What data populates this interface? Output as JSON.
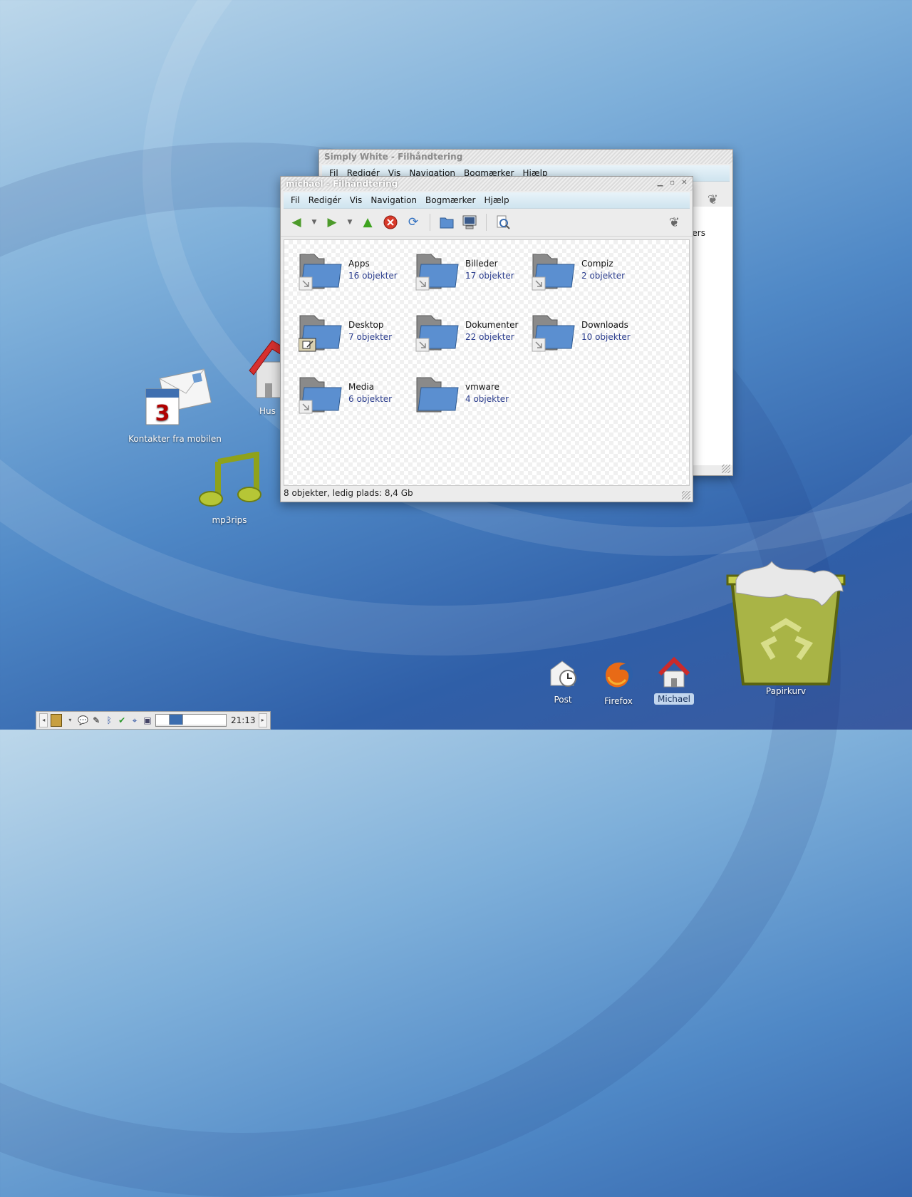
{
  "desktop": {
    "icons": [
      {
        "label": "Kontakter fra mobilen"
      },
      {
        "label": "Hus"
      },
      {
        "label": "mp3rips"
      }
    ],
    "dock": [
      {
        "label": "Post"
      },
      {
        "label": "Firefox"
      },
      {
        "label": "Michael"
      },
      {
        "label": "Papirkurv"
      }
    ]
  },
  "back_window": {
    "title": "Simply White - Filhåndtering",
    "menu": [
      "Fil",
      "Redigér",
      "Vis",
      "Navigation",
      "Bogmærker",
      "Hjælp"
    ],
    "partial_text": "ers"
  },
  "front_window": {
    "title": "michael - Filhåndtering",
    "menu": [
      "Fil",
      "Redigér",
      "Vis",
      "Navigation",
      "Bogmærker",
      "Hjælp"
    ],
    "folders": [
      {
        "name": "Apps",
        "count": "16 objekter"
      },
      {
        "name": "Billeder",
        "count": "17 objekter"
      },
      {
        "name": "Compiz",
        "count": "2 objekter"
      },
      {
        "name": "Desktop",
        "count": "7 objekter"
      },
      {
        "name": "Dokumenter",
        "count": "22 objekter"
      },
      {
        "name": "Downloads",
        "count": "10 objekter"
      },
      {
        "name": "Media",
        "count": "6 objekter"
      },
      {
        "name": "vmware",
        "count": "4 objekter"
      }
    ],
    "status": "8 objekter, ledig plads: 8,4 Gb"
  },
  "panel": {
    "clock": "21:13"
  },
  "colors": {
    "folder": "#5b8fd0",
    "accent": "#2c3e8e",
    "trash": "#a9b446"
  }
}
